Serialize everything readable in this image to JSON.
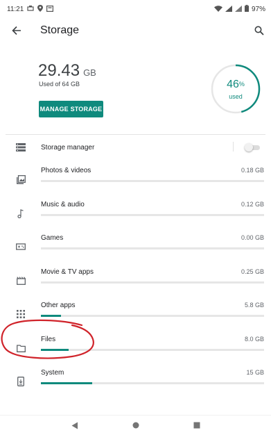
{
  "status_bar": {
    "time": "11:21",
    "battery": "97%"
  },
  "app_bar": {
    "title": "Storage",
    "back_icon": "arrow-back-icon",
    "search_icon": "search-icon"
  },
  "summary": {
    "used_value": "29.43",
    "used_unit": "GB",
    "used_of": "Used of 64 GB",
    "manage_button": "MANAGE STORAGE",
    "percent_value": "46",
    "percent_sign": "%",
    "percent_label": "used",
    "percent_fraction": 0.46
  },
  "storage_manager": {
    "label": "Storage manager",
    "enabled": false
  },
  "categories": [
    {
      "label": "Photos & videos",
      "size": "0.18 GB",
      "fill": 0.0,
      "icon": "photos-icon"
    },
    {
      "label": "Music & audio",
      "size": "0.12 GB",
      "fill": 0.0,
      "icon": "music-note-icon"
    },
    {
      "label": "Games",
      "size": "0.00 GB",
      "fill": 0.0,
      "icon": "gamepad-icon"
    },
    {
      "label": "Movie & TV apps",
      "size": "0.25 GB",
      "fill": 0.0,
      "icon": "movie-icon"
    },
    {
      "label": "Other apps",
      "size": "5.8 GB",
      "fill": 0.09,
      "icon": "apps-grid-icon"
    },
    {
      "label": "Files",
      "size": "8.0 GB",
      "fill": 0.125,
      "icon": "folder-icon"
    },
    {
      "label": "System",
      "size": "15 GB",
      "fill": 0.23,
      "icon": "system-update-icon"
    }
  ],
  "colors": {
    "accent": "#0f8a7d",
    "annotation": "#d0232a",
    "track": "#e6e6e6"
  },
  "nav_bar": {
    "back": "nav-back-icon",
    "home": "nav-home-icon",
    "recents": "nav-recents-icon"
  }
}
